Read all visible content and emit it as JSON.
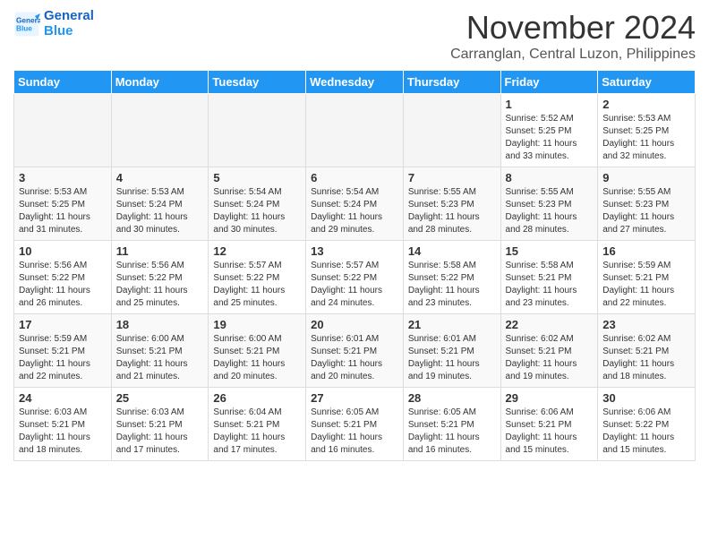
{
  "header": {
    "logo_line1": "General",
    "logo_line2": "Blue",
    "month": "November 2024",
    "location": "Carranglan, Central Luzon, Philippines"
  },
  "weekdays": [
    "Sunday",
    "Monday",
    "Tuesday",
    "Wednesday",
    "Thursday",
    "Friday",
    "Saturday"
  ],
  "weeks": [
    [
      {
        "day": "",
        "empty": true
      },
      {
        "day": "",
        "empty": true
      },
      {
        "day": "",
        "empty": true
      },
      {
        "day": "",
        "empty": true
      },
      {
        "day": "",
        "empty": true
      },
      {
        "day": "1",
        "sunrise": "Sunrise: 5:52 AM",
        "sunset": "Sunset: 5:25 PM",
        "daylight": "Daylight: 11 hours and 33 minutes."
      },
      {
        "day": "2",
        "sunrise": "Sunrise: 5:53 AM",
        "sunset": "Sunset: 5:25 PM",
        "daylight": "Daylight: 11 hours and 32 minutes."
      }
    ],
    [
      {
        "day": "3",
        "sunrise": "Sunrise: 5:53 AM",
        "sunset": "Sunset: 5:25 PM",
        "daylight": "Daylight: 11 hours and 31 minutes."
      },
      {
        "day": "4",
        "sunrise": "Sunrise: 5:53 AM",
        "sunset": "Sunset: 5:24 PM",
        "daylight": "Daylight: 11 hours and 30 minutes."
      },
      {
        "day": "5",
        "sunrise": "Sunrise: 5:54 AM",
        "sunset": "Sunset: 5:24 PM",
        "daylight": "Daylight: 11 hours and 30 minutes."
      },
      {
        "day": "6",
        "sunrise": "Sunrise: 5:54 AM",
        "sunset": "Sunset: 5:24 PM",
        "daylight": "Daylight: 11 hours and 29 minutes."
      },
      {
        "day": "7",
        "sunrise": "Sunrise: 5:55 AM",
        "sunset": "Sunset: 5:23 PM",
        "daylight": "Daylight: 11 hours and 28 minutes."
      },
      {
        "day": "8",
        "sunrise": "Sunrise: 5:55 AM",
        "sunset": "Sunset: 5:23 PM",
        "daylight": "Daylight: 11 hours and 28 minutes."
      },
      {
        "day": "9",
        "sunrise": "Sunrise: 5:55 AM",
        "sunset": "Sunset: 5:23 PM",
        "daylight": "Daylight: 11 hours and 27 minutes."
      }
    ],
    [
      {
        "day": "10",
        "sunrise": "Sunrise: 5:56 AM",
        "sunset": "Sunset: 5:22 PM",
        "daylight": "Daylight: 11 hours and 26 minutes."
      },
      {
        "day": "11",
        "sunrise": "Sunrise: 5:56 AM",
        "sunset": "Sunset: 5:22 PM",
        "daylight": "Daylight: 11 hours and 25 minutes."
      },
      {
        "day": "12",
        "sunrise": "Sunrise: 5:57 AM",
        "sunset": "Sunset: 5:22 PM",
        "daylight": "Daylight: 11 hours and 25 minutes."
      },
      {
        "day": "13",
        "sunrise": "Sunrise: 5:57 AM",
        "sunset": "Sunset: 5:22 PM",
        "daylight": "Daylight: 11 hours and 24 minutes."
      },
      {
        "day": "14",
        "sunrise": "Sunrise: 5:58 AM",
        "sunset": "Sunset: 5:22 PM",
        "daylight": "Daylight: 11 hours and 23 minutes."
      },
      {
        "day": "15",
        "sunrise": "Sunrise: 5:58 AM",
        "sunset": "Sunset: 5:21 PM",
        "daylight": "Daylight: 11 hours and 23 minutes."
      },
      {
        "day": "16",
        "sunrise": "Sunrise: 5:59 AM",
        "sunset": "Sunset: 5:21 PM",
        "daylight": "Daylight: 11 hours and 22 minutes."
      }
    ],
    [
      {
        "day": "17",
        "sunrise": "Sunrise: 5:59 AM",
        "sunset": "Sunset: 5:21 PM",
        "daylight": "Daylight: 11 hours and 22 minutes."
      },
      {
        "day": "18",
        "sunrise": "Sunrise: 6:00 AM",
        "sunset": "Sunset: 5:21 PM",
        "daylight": "Daylight: 11 hours and 21 minutes."
      },
      {
        "day": "19",
        "sunrise": "Sunrise: 6:00 AM",
        "sunset": "Sunset: 5:21 PM",
        "daylight": "Daylight: 11 hours and 20 minutes."
      },
      {
        "day": "20",
        "sunrise": "Sunrise: 6:01 AM",
        "sunset": "Sunset: 5:21 PM",
        "daylight": "Daylight: 11 hours and 20 minutes."
      },
      {
        "day": "21",
        "sunrise": "Sunrise: 6:01 AM",
        "sunset": "Sunset: 5:21 PM",
        "daylight": "Daylight: 11 hours and 19 minutes."
      },
      {
        "day": "22",
        "sunrise": "Sunrise: 6:02 AM",
        "sunset": "Sunset: 5:21 PM",
        "daylight": "Daylight: 11 hours and 19 minutes."
      },
      {
        "day": "23",
        "sunrise": "Sunrise: 6:02 AM",
        "sunset": "Sunset: 5:21 PM",
        "daylight": "Daylight: 11 hours and 18 minutes."
      }
    ],
    [
      {
        "day": "24",
        "sunrise": "Sunrise: 6:03 AM",
        "sunset": "Sunset: 5:21 PM",
        "daylight": "Daylight: 11 hours and 18 minutes."
      },
      {
        "day": "25",
        "sunrise": "Sunrise: 6:03 AM",
        "sunset": "Sunset: 5:21 PM",
        "daylight": "Daylight: 11 hours and 17 minutes."
      },
      {
        "day": "26",
        "sunrise": "Sunrise: 6:04 AM",
        "sunset": "Sunset: 5:21 PM",
        "daylight": "Daylight: 11 hours and 17 minutes."
      },
      {
        "day": "27",
        "sunrise": "Sunrise: 6:05 AM",
        "sunset": "Sunset: 5:21 PM",
        "daylight": "Daylight: 11 hours and 16 minutes."
      },
      {
        "day": "28",
        "sunrise": "Sunrise: 6:05 AM",
        "sunset": "Sunset: 5:21 PM",
        "daylight": "Daylight: 11 hours and 16 minutes."
      },
      {
        "day": "29",
        "sunrise": "Sunrise: 6:06 AM",
        "sunset": "Sunset: 5:21 PM",
        "daylight": "Daylight: 11 hours and 15 minutes."
      },
      {
        "day": "30",
        "sunrise": "Sunrise: 6:06 AM",
        "sunset": "Sunset: 5:22 PM",
        "daylight": "Daylight: 11 hours and 15 minutes."
      }
    ]
  ]
}
